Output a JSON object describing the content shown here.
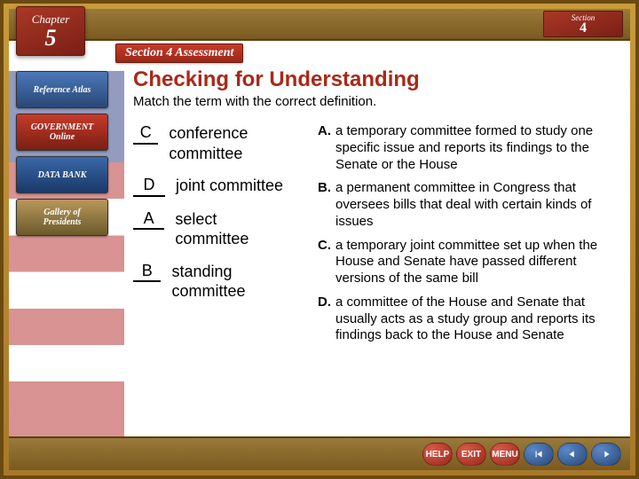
{
  "top": {
    "chapter_label": "Chapter",
    "chapter_num": "5",
    "section_label": "Section",
    "section_num": "4"
  },
  "assessment_label": "Section 4 Assessment",
  "sidebar": {
    "reference": "Reference Atlas",
    "government": "GOVERNMENT",
    "online": "Online",
    "databank": "DATA BANK",
    "gallery_line1": "Gallery of",
    "gallery_line2": "Presidents"
  },
  "heading": "Checking for Understanding",
  "instructions": "Match the term with the correct definition.",
  "terms": [
    {
      "answer": "C",
      "text": "conference committee"
    },
    {
      "answer": "D",
      "text": "joint committee"
    },
    {
      "answer": "A",
      "text": "select committee"
    },
    {
      "answer": "B",
      "text": "standing committee"
    }
  ],
  "definitions": [
    {
      "letter": "A.",
      "text": "a temporary committee formed to study one specific issue and reports its findings to the Senate or the House"
    },
    {
      "letter": "B.",
      "text": "a permanent committee in Congress that oversees bills that deal with certain kinds of issues"
    },
    {
      "letter": "C.",
      "text": "a temporary joint committee set up when the House and Senate have passed different versions of the same bill"
    },
    {
      "letter": "D.",
      "text": "a committee of the House and Senate that usually acts as a study group and reports its findings back to the House and Senate"
    }
  ],
  "nav": {
    "help": "HELP",
    "exit": "EXIT",
    "menu": "MENU"
  }
}
